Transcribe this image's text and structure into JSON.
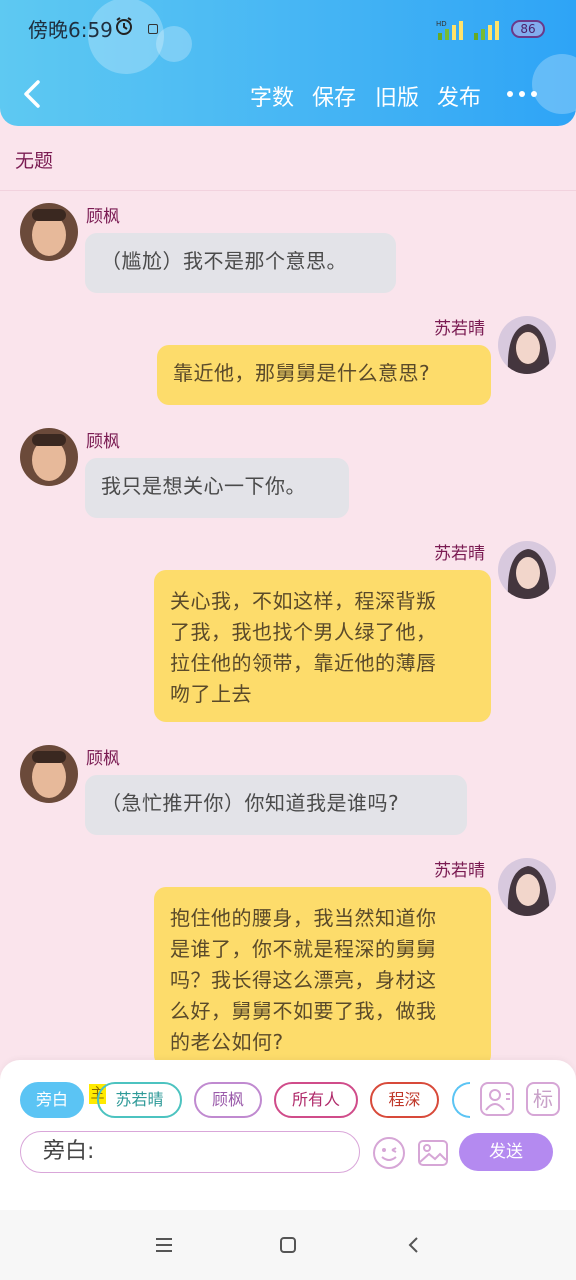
{
  "status": {
    "time": "傍晚6:59",
    "battery": "86"
  },
  "header": {
    "actions": {
      "word_count": "字数",
      "save": "保存",
      "old_version": "旧版",
      "publish": "发布"
    }
  },
  "doc": {
    "title": "无题"
  },
  "messages": [
    {
      "side": "left",
      "name": "顾枫",
      "text": "（尴尬）我不是那个意思。"
    },
    {
      "side": "right",
      "name": "苏若晴",
      "text": "靠近他，那舅舅是什么意思?"
    },
    {
      "side": "left",
      "name": "顾枫",
      "text": "我只是想关心一下你。"
    },
    {
      "side": "right",
      "name": "苏若晴",
      "lines": [
        "关心我，不如这样，程深背叛",
        "了我，我也找个男人绿了他，",
        "拉住他的领带，靠近他的薄唇",
        "吻了上去"
      ]
    },
    {
      "side": "left",
      "name": "顾枫",
      "text": "（急忙推开你）你知道我是谁吗?"
    },
    {
      "side": "right",
      "name": "苏若晴",
      "lines": [
        "抱住他的腰身，我当然知道你",
        "是谁了，你不就是程深的舅舅",
        "吗？我长得这么漂亮，身材这",
        "么好，舅舅不如要了我，做我",
        "的老公如何?"
      ]
    }
  ],
  "composer": {
    "roles": [
      "旁白",
      "苏若晴",
      "顾枫",
      "所有人",
      "程深"
    ],
    "main_tag": "主",
    "tag_button": "标",
    "input_value": "旁白:",
    "send_label": "发送"
  },
  "colors": {
    "header_start": "#5ec9f2",
    "header_end": "#2ea4f6",
    "page_bg": "#fae4ec",
    "left_bubble": "#e3e3e8",
    "right_bubble": "#fddc6b",
    "name_color": "#7a1b52",
    "send_button": "#b48af0",
    "selected_chip": "#5bc4f4"
  }
}
